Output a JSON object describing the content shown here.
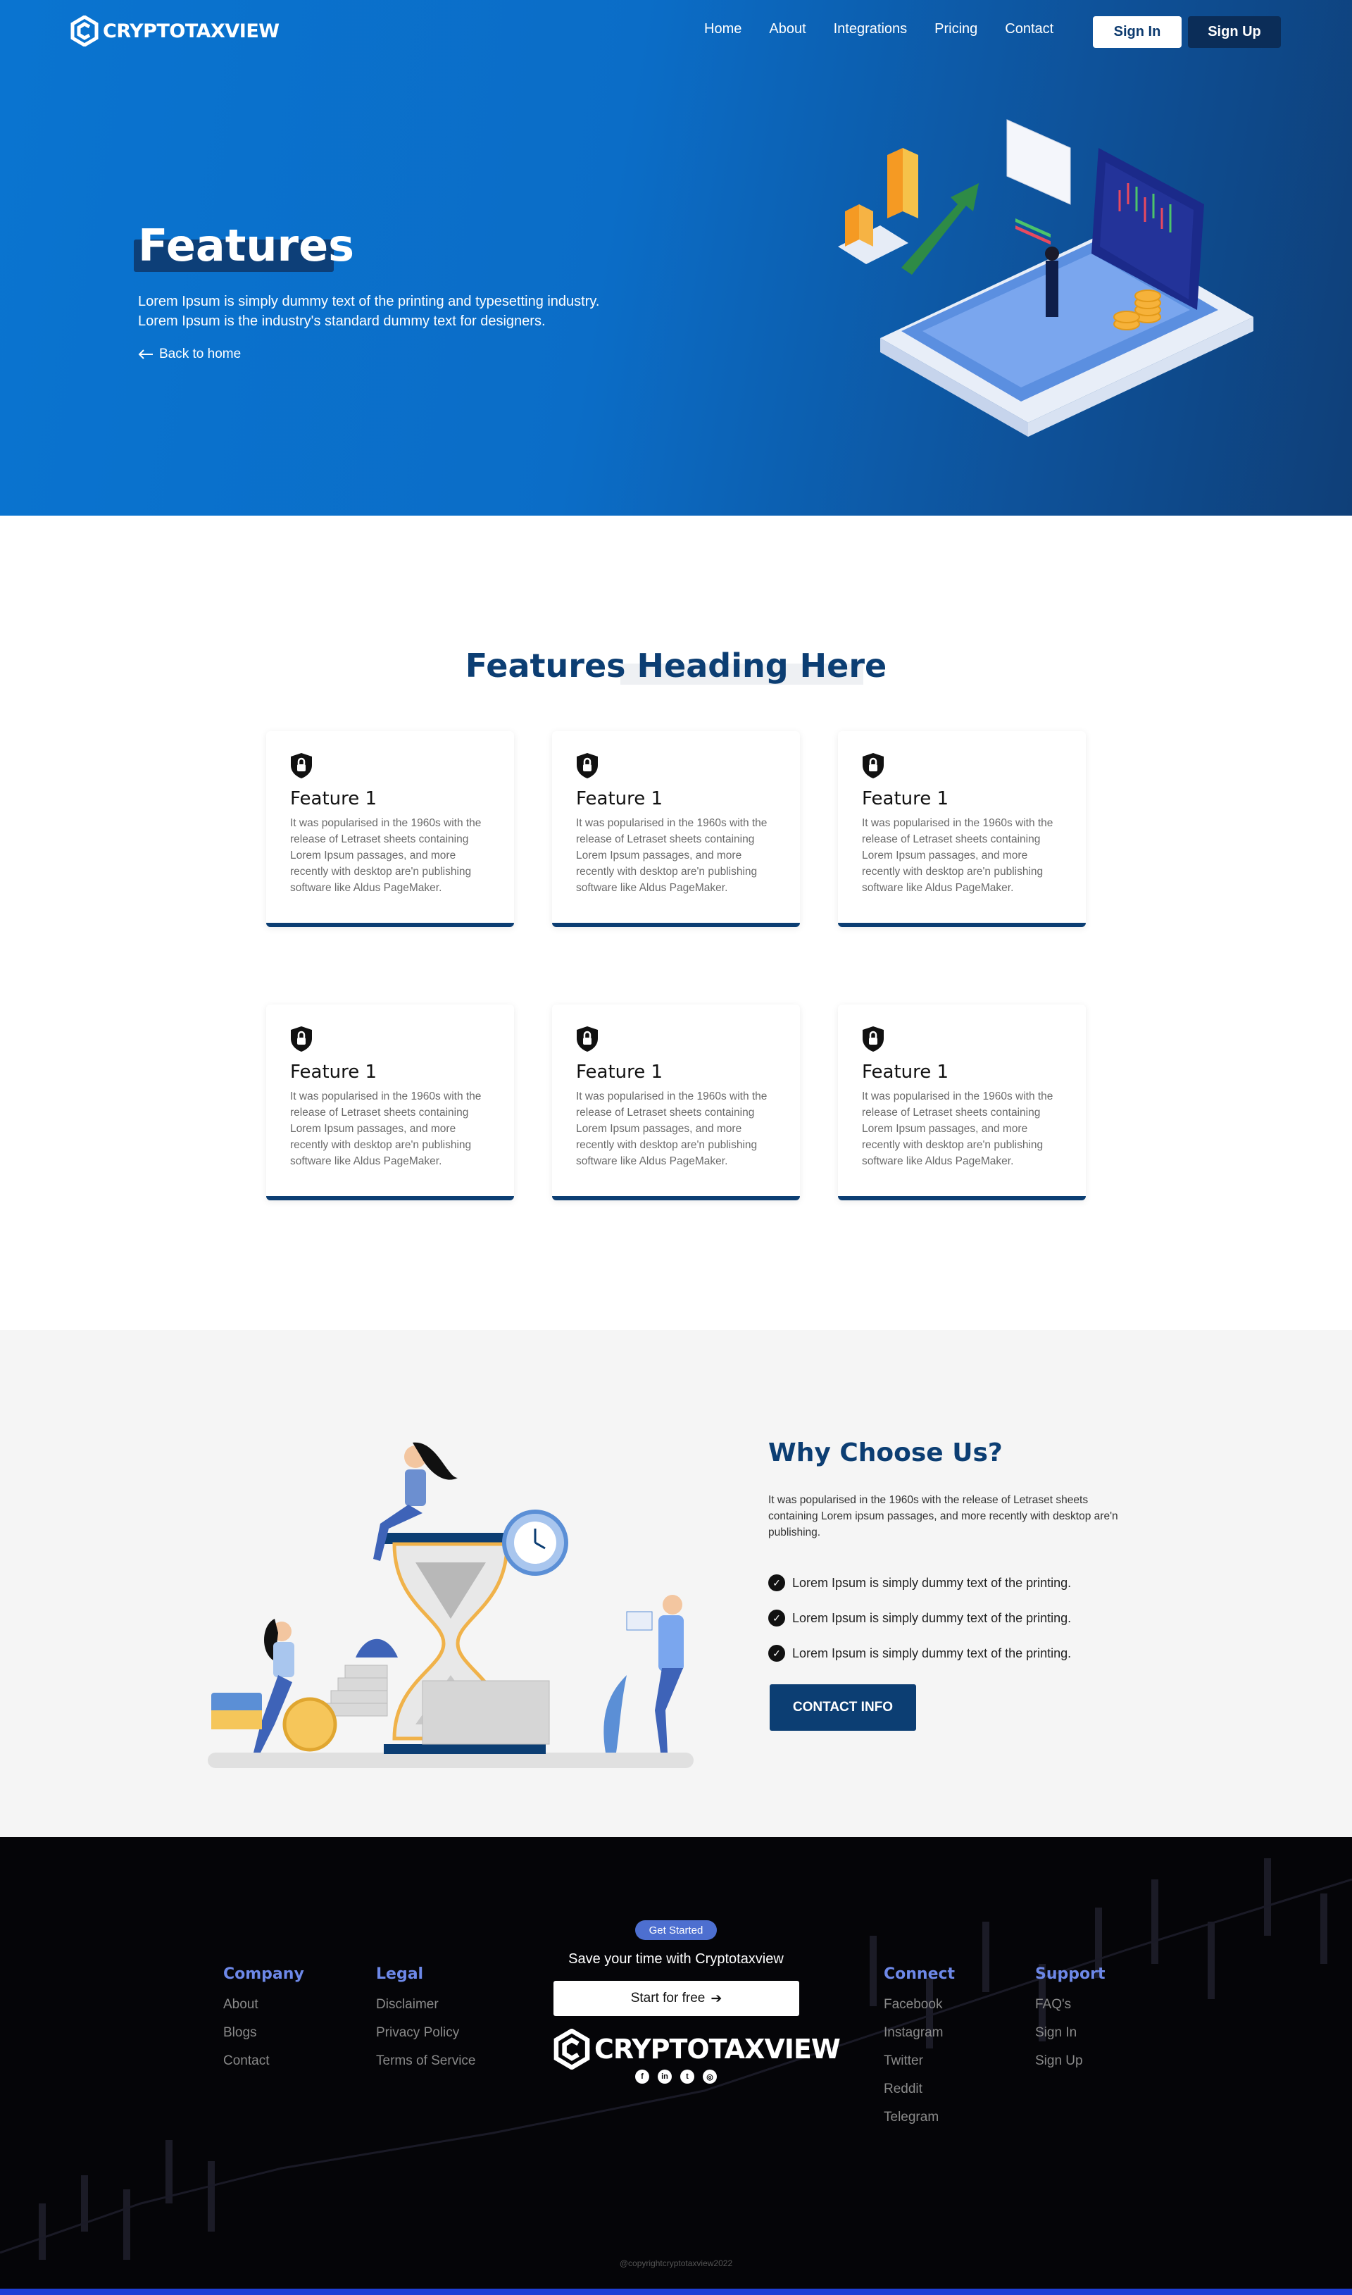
{
  "header": {
    "logo": "CRYPTOTAXVIEW",
    "nav": [
      "Home",
      "About",
      "Integrations",
      "Pricing",
      "Contact"
    ],
    "signin": "Sign In",
    "signup": "Sign Up"
  },
  "hero": {
    "title": "Features",
    "description": "Lorem Ipsum is simply dummy text of the printing and typesetting industry. Lorem Ipsum is the industry's standard dummy text for designers.",
    "back": "Back to home"
  },
  "features": {
    "heading": "Features Heading Here",
    "cards": [
      {
        "title": "Feature 1",
        "text": "It was popularised in the 1960s with the release of Letraset sheets containing Lorem Ipsum passages, and more recently with desktop are'n publishing software like Aldus PageMaker."
      },
      {
        "title": "Feature 1",
        "text": "It was popularised in the 1960s with the release of Letraset sheets containing Lorem Ipsum passages, and more recently with desktop are'n publishing software like Aldus PageMaker."
      },
      {
        "title": "Feature 1",
        "text": "It was popularised in the 1960s with the release of Letraset sheets containing Lorem Ipsum passages, and more recently with desktop are'n publishing software like Aldus PageMaker."
      },
      {
        "title": "Feature 1",
        "text": "It was popularised in the 1960s with the release of Letraset sheets containing Lorem Ipsum passages, and more recently with desktop are'n publishing software like Aldus PageMaker."
      },
      {
        "title": "Feature 1",
        "text": "It was popularised in the 1960s with the release of Letraset sheets containing Lorem Ipsum passages, and more recently with desktop are'n publishing software like Aldus PageMaker."
      },
      {
        "title": "Feature 1",
        "text": "It was popularised in the 1960s with the release of Letraset sheets containing Lorem Ipsum passages, and more recently with desktop are'n publishing software like Aldus PageMaker."
      }
    ]
  },
  "why": {
    "title": "Why Choose Us?",
    "description": "It was popularised in the 1960s with the release of Letraset sheets containing Lorem ipsum passages, and more recently with desktop are'n publishing.",
    "items": [
      "Lorem Ipsum is simply dummy text of the printing.",
      "Lorem Ipsum is simply dummy text of the printing.",
      "Lorem Ipsum is simply dummy text of the printing."
    ],
    "button": "CONTACT INFO"
  },
  "footer": {
    "company": {
      "title": "Company",
      "links": [
        "About",
        "Blogs",
        "Contact"
      ]
    },
    "legal": {
      "title": "Legal",
      "links": [
        "Disclaimer",
        "Privacy Policy",
        "Terms of Service"
      ]
    },
    "connect": {
      "title": "Connect",
      "links": [
        "Facebook",
        "Instagram",
        "Twitter",
        "Reddit",
        "Telegram"
      ]
    },
    "support": {
      "title": "Support",
      "links": [
        "FAQ's",
        "Sign In",
        "Sign Up"
      ]
    },
    "badge": "Get Started",
    "tagline": "Save your time with Cryptotaxview",
    "start": "Start for free",
    "logo": "CRYPTOTAXVIEW",
    "socials": [
      "facebook-icon",
      "linkedin-icon",
      "twitter-icon",
      "instagram-icon"
    ],
    "copyright": "@copyrightcryptotaxview2022"
  },
  "colors": {
    "primary": "#0c3e73",
    "hero_blue": "#0a74d0",
    "accent": "#6d88e8",
    "footer_bg": "#050508"
  }
}
